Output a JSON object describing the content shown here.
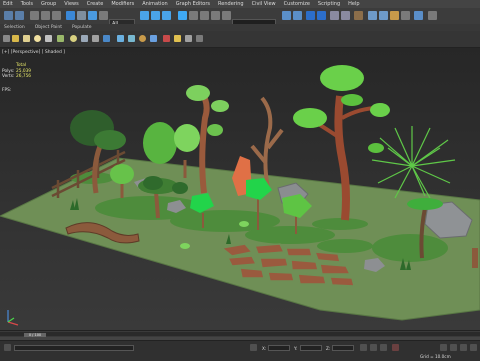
{
  "menu": [
    "Edit",
    "Tools",
    "Group",
    "Views",
    "Create",
    "Modifiers",
    "Animation",
    "Graph Editors",
    "Rendering",
    "Civil View",
    "Customize",
    "Scripting",
    "Help"
  ],
  "toolbar": {
    "selection_set": "All"
  },
  "ribbon_tabs": [
    "Selection",
    "Object Paint",
    "Populate"
  ],
  "viewport": {
    "label": "[+] [Perspective] [ Shaded ]",
    "stats": {
      "header": "Total",
      "polys_label": "Polys:",
      "polys": "25,039",
      "verts_label": "Verts:",
      "verts": "26,756"
    },
    "fps_label": "FPS:"
  },
  "timeline": {
    "frame": "0 / 100"
  },
  "status": {
    "grid": "Grid = 10.0cm",
    "x_label": "X:",
    "y_label": "Y:",
    "z_label": "Z:"
  },
  "colors": {
    "ground": "#6f8f56",
    "grass": "#4e8c3c",
    "trunk": "#9a5a3c",
    "foliage": "#46c444"
  }
}
